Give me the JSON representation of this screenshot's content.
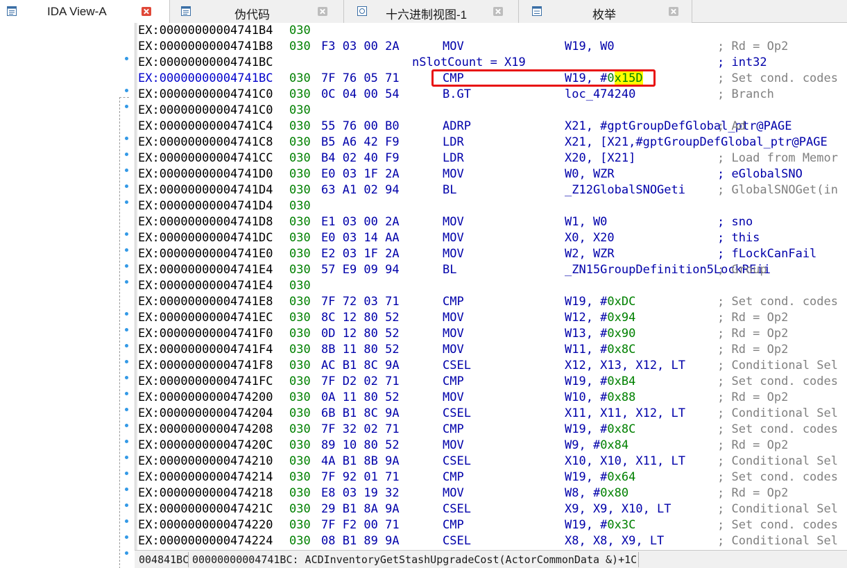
{
  "tabs": [
    {
      "label": "IDA View-A",
      "icon": "listing-icon",
      "active": true
    },
    {
      "label": "伪代码",
      "icon": "listing-icon",
      "active": false
    },
    {
      "label": "十六进制视图-1",
      "icon": "hex-view-icon",
      "active": false
    },
    {
      "label": "枚举",
      "icon": "enum-icon",
      "active": false
    }
  ],
  "lines": [
    {
      "addr": "EX:00000000004741B4",
      "seg": "030",
      "bytes": "",
      "mnem": "",
      "ops": "",
      "cmt": "",
      "var": ""
    },
    {
      "addr": "EX:00000000004741B8",
      "seg": "030",
      "bytes": "F3 03 00 2A",
      "mnem": "MOV",
      "ops": "W19, W0",
      "cmt": "; Rd = Op2",
      "var": ""
    },
    {
      "addr": "EX:00000000004741BC",
      "seg": "",
      "bytes": "",
      "mnem": "",
      "ops": "",
      "cmt": "; int32",
      "var": "nSlotCount = X19",
      "cmtBlue": true
    },
    {
      "addr": "EX:00000000004741BC",
      "seg": "030",
      "bytes": "7F 76 05 71",
      "mnem": "CMP",
      "ops": "W19, #0x15D",
      "cmt": "; Set cond. codes",
      "var": "",
      "current": true
    },
    {
      "addr": "EX:00000000004741C0",
      "seg": "030",
      "bytes": "0C 04 00 54",
      "mnem": "B.GT",
      "ops": "loc_474240",
      "cmt": "; Branch",
      "var": ""
    },
    {
      "addr": "EX:00000000004741C0",
      "seg": "030",
      "bytes": "",
      "mnem": "",
      "ops": "",
      "cmt": "",
      "var": ""
    },
    {
      "addr": "EX:00000000004741C4",
      "seg": "030",
      "bytes": "55 76 00 B0",
      "mnem": "ADRP",
      "ops": "X21, #gptGroupDefGlobal_ptr@PAGE",
      "cmt": "; Ad",
      "var": ""
    },
    {
      "addr": "EX:00000000004741C8",
      "seg": "030",
      "bytes": "B5 A6 42 F9",
      "mnem": "LDR",
      "ops": "X21, [X21,#gptGroupDefGlobal_ptr@PAGE",
      "cmt": "",
      "var": ""
    },
    {
      "addr": "EX:00000000004741CC",
      "seg": "030",
      "bytes": "B4 02 40 F9",
      "mnem": "LDR",
      "ops": "X20, [X21]",
      "cmt": "; Load from Memor",
      "var": ""
    },
    {
      "addr": "EX:00000000004741D0",
      "seg": "030",
      "bytes": "E0 03 1F 2A",
      "mnem": "MOV",
      "ops": "W0, WZR",
      "cmt": "; eGlobalSNO",
      "var": "",
      "cmtBlue": true
    },
    {
      "addr": "EX:00000000004741D4",
      "seg": "030",
      "bytes": "63 A1 02 94",
      "mnem": "BL",
      "ops": "_Z12GlobalSNOGeti",
      "cmt": "; GlobalSNOGet(in",
      "var": ""
    },
    {
      "addr": "EX:00000000004741D4",
      "seg": "030",
      "bytes": "",
      "mnem": "",
      "ops": "",
      "cmt": "",
      "var": ""
    },
    {
      "addr": "EX:00000000004741D8",
      "seg": "030",
      "bytes": "E1 03 00 2A",
      "mnem": "MOV",
      "ops": "W1, W0",
      "cmt": "; sno",
      "var": "",
      "cmtBlue": true
    },
    {
      "addr": "EX:00000000004741DC",
      "seg": "030",
      "bytes": "E0 03 14 AA",
      "mnem": "MOV",
      "ops": "X0, X20",
      "cmt": "; this",
      "var": "",
      "cmtBlue": true
    },
    {
      "addr": "EX:00000000004741E0",
      "seg": "030",
      "bytes": "E2 03 1F 2A",
      "mnem": "MOV",
      "ops": "W2, WZR",
      "cmt": "; fLockCanFail",
      "var": "",
      "cmtBlue": true
    },
    {
      "addr": "EX:00000000004741E4",
      "seg": "030",
      "bytes": "57 E9 09 94",
      "mnem": "BL",
      "ops": "_ZN15GroupDefinition5LockREii",
      "cmt": "; Group",
      "var": ""
    },
    {
      "addr": "EX:00000000004741E4",
      "seg": "030",
      "bytes": "",
      "mnem": "",
      "ops": "",
      "cmt": "",
      "var": ""
    },
    {
      "addr": "EX:00000000004741E8",
      "seg": "030",
      "bytes": "7F 72 03 71",
      "mnem": "CMP",
      "ops": "W19, #0xDC",
      "cmt": "; Set cond. codes",
      "var": ""
    },
    {
      "addr": "EX:00000000004741EC",
      "seg": "030",
      "bytes": "8C 12 80 52",
      "mnem": "MOV",
      "ops": "W12, #0x94",
      "cmt": "; Rd = Op2",
      "var": ""
    },
    {
      "addr": "EX:00000000004741F0",
      "seg": "030",
      "bytes": "0D 12 80 52",
      "mnem": "MOV",
      "ops": "W13, #0x90",
      "cmt": "; Rd = Op2",
      "var": ""
    },
    {
      "addr": "EX:00000000004741F4",
      "seg": "030",
      "bytes": "8B 11 80 52",
      "mnem": "MOV",
      "ops": "W11, #0x8C",
      "cmt": "; Rd = Op2",
      "var": ""
    },
    {
      "addr": "EX:00000000004741F8",
      "seg": "030",
      "bytes": "AC B1 8C 9A",
      "mnem": "CSEL",
      "ops": "X12, X13, X12, LT",
      "cmt": "; Conditional Sel",
      "var": ""
    },
    {
      "addr": "EX:00000000004741FC",
      "seg": "030",
      "bytes": "7F D2 02 71",
      "mnem": "CMP",
      "ops": "W19, #0xB4",
      "cmt": "; Set cond. codes",
      "var": ""
    },
    {
      "addr": "EX:0000000000474200",
      "seg": "030",
      "bytes": "0A 11 80 52",
      "mnem": "MOV",
      "ops": "W10, #0x88",
      "cmt": "; Rd = Op2",
      "var": ""
    },
    {
      "addr": "EX:0000000000474204",
      "seg": "030",
      "bytes": "6B B1 8C 9A",
      "mnem": "CSEL",
      "ops": "X11, X11, X12, LT",
      "cmt": "; Conditional Sel",
      "var": ""
    },
    {
      "addr": "EX:0000000000474208",
      "seg": "030",
      "bytes": "7F 32 02 71",
      "mnem": "CMP",
      "ops": "W19, #0x8C",
      "cmt": "; Set cond. codes",
      "var": ""
    },
    {
      "addr": "EX:000000000047420C",
      "seg": "030",
      "bytes": "89 10 80 52",
      "mnem": "MOV",
      "ops": "W9, #0x84",
      "cmt": "; Rd = Op2",
      "var": ""
    },
    {
      "addr": "EX:0000000000474210",
      "seg": "030",
      "bytes": "4A B1 8B 9A",
      "mnem": "CSEL",
      "ops": "X10, X10, X11, LT",
      "cmt": "; Conditional Sel",
      "var": ""
    },
    {
      "addr": "EX:0000000000474214",
      "seg": "030",
      "bytes": "7F 92 01 71",
      "mnem": "CMP",
      "ops": "W19, #0x64",
      "cmt": "; Set cond. codes",
      "var": ""
    },
    {
      "addr": "EX:0000000000474218",
      "seg": "030",
      "bytes": "E8 03 19 32",
      "mnem": "MOV",
      "ops": "W8, #0x80",
      "cmt": "; Rd = Op2",
      "var": ""
    },
    {
      "addr": "EX:000000000047421C",
      "seg": "030",
      "bytes": "29 B1 8A 9A",
      "mnem": "CSEL",
      "ops": "X9, X9, X10, LT",
      "cmt": "; Conditional Sel",
      "var": ""
    },
    {
      "addr": "EX:0000000000474220",
      "seg": "030",
      "bytes": "7F F2 00 71",
      "mnem": "CMP",
      "ops": "W19, #0x3C",
      "cmt": "; Set cond. codes",
      "var": ""
    },
    {
      "addr": "EX:0000000000474224",
      "seg": "030",
      "bytes": "08 B1 89 9A",
      "mnem": "CSEL",
      "ops": "X8, X8, X9, LT",
      "cmt": "; Conditional Sel",
      "var": ""
    }
  ],
  "highlight_text": "0x15D",
  "status": {
    "address": "004841BC",
    "description": "00000000004741BC: ACDInventoryGetStashUpgradeCost(ActorCommonData &)+1C"
  },
  "colors": {
    "accent_blue": "#0000aa",
    "segment_green": "#008000",
    "comment_gray": "#808080",
    "highlight_yellow": "#ffff00",
    "annotation_red": "#e81010",
    "tab_close_red": "#e04838"
  }
}
